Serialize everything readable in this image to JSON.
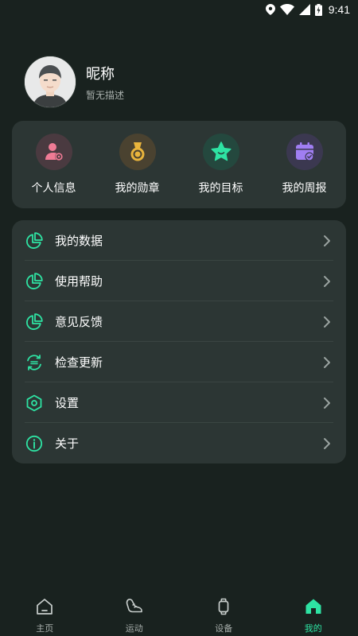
{
  "status": {
    "time": "9:41"
  },
  "profile": {
    "nickname": "昵称",
    "description": "暂无描述"
  },
  "quick_actions": [
    {
      "label": "个人信息",
      "icon": "person-icon",
      "color": "#f07b95"
    },
    {
      "label": "我的勋章",
      "icon": "medal-icon",
      "color": "#e9b43c"
    },
    {
      "label": "我的目标",
      "icon": "star-icon",
      "color": "#2ee3a3"
    },
    {
      "label": "我的周报",
      "icon": "calendar-icon",
      "color": "#a07ef2"
    }
  ],
  "menu": [
    {
      "label": "我的数据",
      "icon": "pie-chart-icon"
    },
    {
      "label": "使用帮助",
      "icon": "pie-chart-icon"
    },
    {
      "label": "意见反馈",
      "icon": "pie-chart-icon"
    },
    {
      "label": "检查更新",
      "icon": "refresh-icon"
    },
    {
      "label": "设置",
      "icon": "hexagon-settings-icon"
    },
    {
      "label": "关于",
      "icon": "info-icon"
    }
  ],
  "tabs": [
    {
      "label": "主页",
      "icon": "home-icon",
      "active": false
    },
    {
      "label": "运动",
      "icon": "shoe-icon",
      "active": false
    },
    {
      "label": "设备",
      "icon": "watch-icon",
      "active": false
    },
    {
      "label": "我的",
      "icon": "home-filled-icon",
      "active": true
    }
  ],
  "colors": {
    "accent": "#2ee3a3",
    "background": "#19221f",
    "card": "#2c3634"
  }
}
